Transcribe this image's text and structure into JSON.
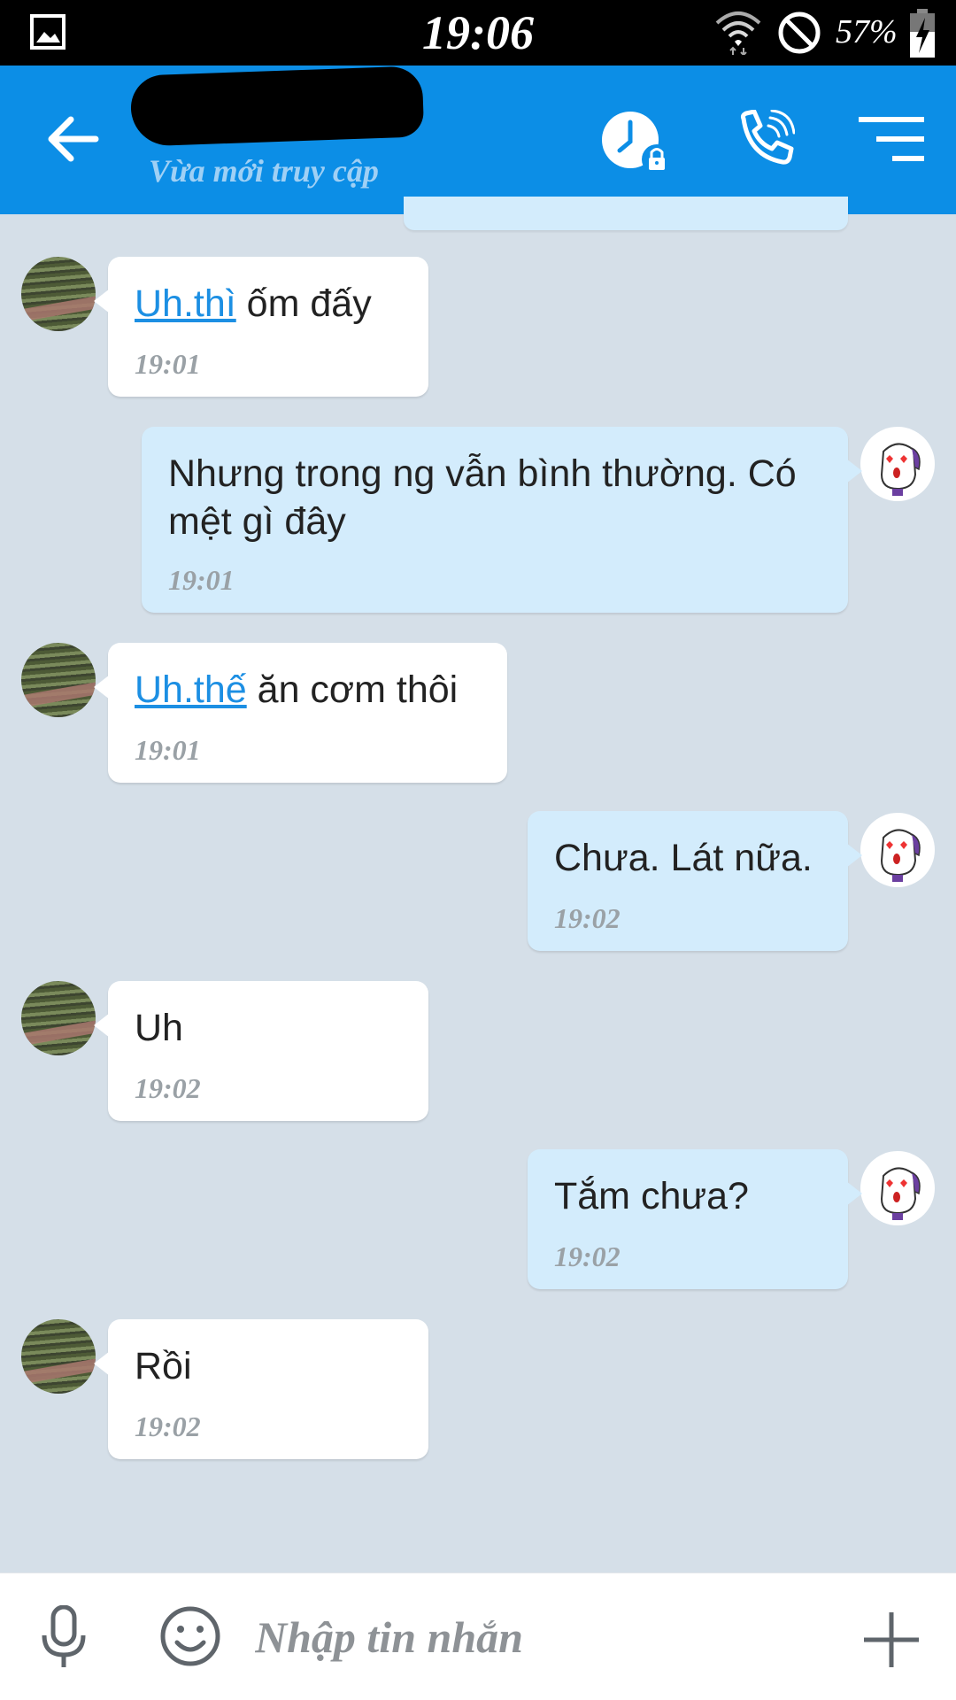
{
  "status_bar": {
    "time": "19:06",
    "battery": "57%",
    "icons": [
      "gallery-icon",
      "wifi-icon",
      "do-not-disturb-icon",
      "battery-charging-icon"
    ]
  },
  "header": {
    "contact_name": "",
    "contact_status": "Vừa mới truy cập",
    "icons": [
      "back-arrow-icon",
      "clock-lock-icon",
      "phone-call-icon",
      "menu-icon"
    ],
    "accent_color": "#0c8ee6"
  },
  "messages": [
    {
      "side": "in",
      "link": "Uh.thì",
      "text": " ốm đấy",
      "time": "19:01"
    },
    {
      "side": "out",
      "link": "",
      "text": "Nhưng trong ng vẫn bình thường. Có mệt gì đây",
      "time": "19:01"
    },
    {
      "side": "in",
      "link": "Uh.thế",
      "text": " ăn cơm thôi",
      "time": "19:01"
    },
    {
      "side": "out",
      "link": "",
      "text": "Chưa. Lát nữa.",
      "time": "19:02"
    },
    {
      "side": "in",
      "link": "",
      "text": "Uh",
      "time": "19:02"
    },
    {
      "side": "out",
      "link": "",
      "text": "Tắm chưa?",
      "time": "19:02"
    },
    {
      "side": "in",
      "link": "",
      "text": "Rồi",
      "time": "19:02"
    }
  ],
  "input": {
    "placeholder": "Nhập tin nhắn",
    "value": "",
    "icons": [
      "microphone-icon",
      "emoji-icon",
      "plus-icon"
    ]
  },
  "colors": {
    "chat_background": "#d5dfe8",
    "incoming_bubble": "#ffffff",
    "outgoing_bubble": "#d3ecfc",
    "link": "#1c8fe3"
  }
}
